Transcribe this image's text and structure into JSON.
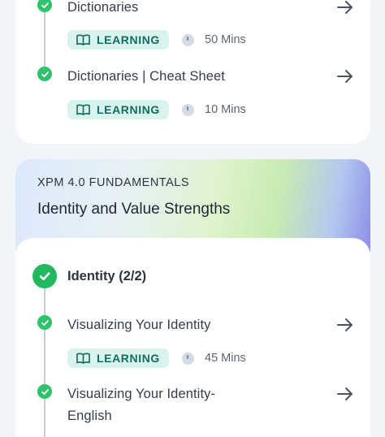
{
  "top_card": {
    "items": [
      {
        "title": "Dictionaries",
        "badge": "LEARNING",
        "duration": "50 Mins"
      },
      {
        "title": "Dictionaries | Cheat Sheet",
        "badge": "LEARNING",
        "duration": "10 Mins"
      }
    ]
  },
  "course": {
    "kicker": "XPM 4.0 FUNDAMENTALS",
    "title": "Identity and Value Strengths"
  },
  "section": {
    "title": "Identity (2/2)",
    "items": [
      {
        "title": "Visualizing Your Identity",
        "badge": "LEARNING",
        "duration": "45 Mins"
      },
      {
        "title_line1": "Visualizing Your Identity-",
        "title_line2": "English"
      }
    ]
  },
  "colors": {
    "check_green": "#2ec36b",
    "badge_bg": "#dbf3ee",
    "badge_text": "#0f6f5f"
  }
}
